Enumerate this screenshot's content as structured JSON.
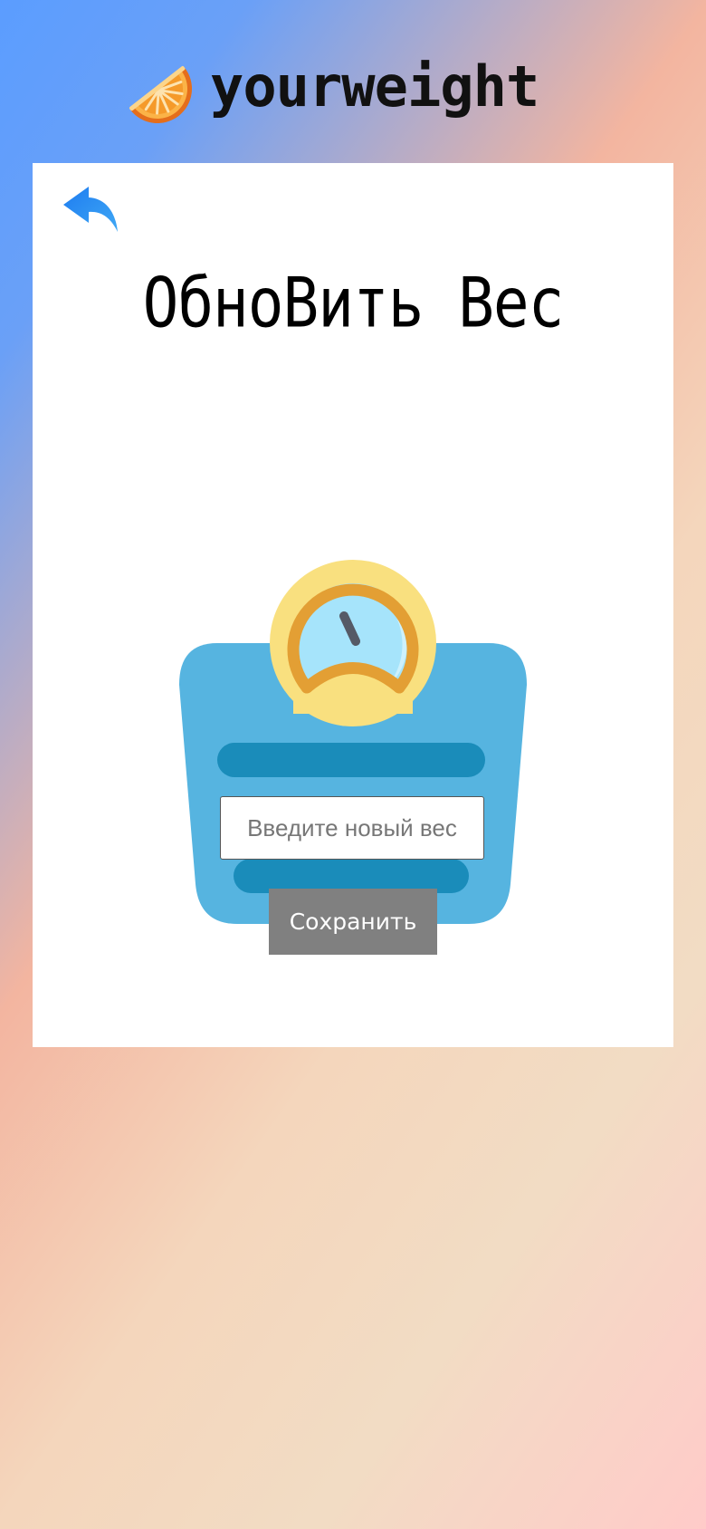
{
  "header": {
    "brand_name": "yourweight",
    "logo_icon": "orange-slice-icon"
  },
  "card": {
    "back_icon": "reply-arrow-icon",
    "title": "ОбноВить Вес",
    "illustration_icon": "bathroom-scale-icon",
    "weight_input": {
      "placeholder": "Введите новый вес",
      "value": ""
    },
    "save_label": "Сохранить"
  },
  "colors": {
    "accent_blue": "#2d8cf0",
    "scale_body": "#56b4e0",
    "scale_stripes": "#1a8cba",
    "dial_face": "#f9e07f",
    "dial_ring": "#e39f34",
    "button_gray": "#808080"
  }
}
